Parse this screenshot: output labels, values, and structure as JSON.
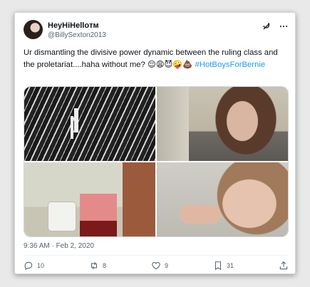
{
  "tweet": {
    "display_name": "HeyHiHelloᴛᴍ",
    "handle": "@BillySexton2013",
    "text": "Ur dismantling the divisive power dynamic between the ruling class and the proletariat....haha without me? 😌😩😈🤪💩",
    "hashtag": "#HotBoysForBernie",
    "timestamp": "9:36 AM · Feb 2, 2020",
    "photos": [
      "photo-top-left",
      "photo-top-right",
      "photo-bottom-left",
      "photo-bottom-right"
    ]
  },
  "actions": {
    "replies": "10",
    "reposts": "8",
    "likes": "9",
    "bookmarks": "31"
  },
  "icons": {
    "grok": "grok-icon",
    "more": "more-icon",
    "reply": "reply-icon",
    "repost": "repost-icon",
    "like": "heart-icon",
    "bookmark": "bookmark-icon",
    "share": "share-icon"
  },
  "colors": {
    "accent": "#1d9bf0",
    "text": "#0f1419",
    "muted": "#536471"
  }
}
